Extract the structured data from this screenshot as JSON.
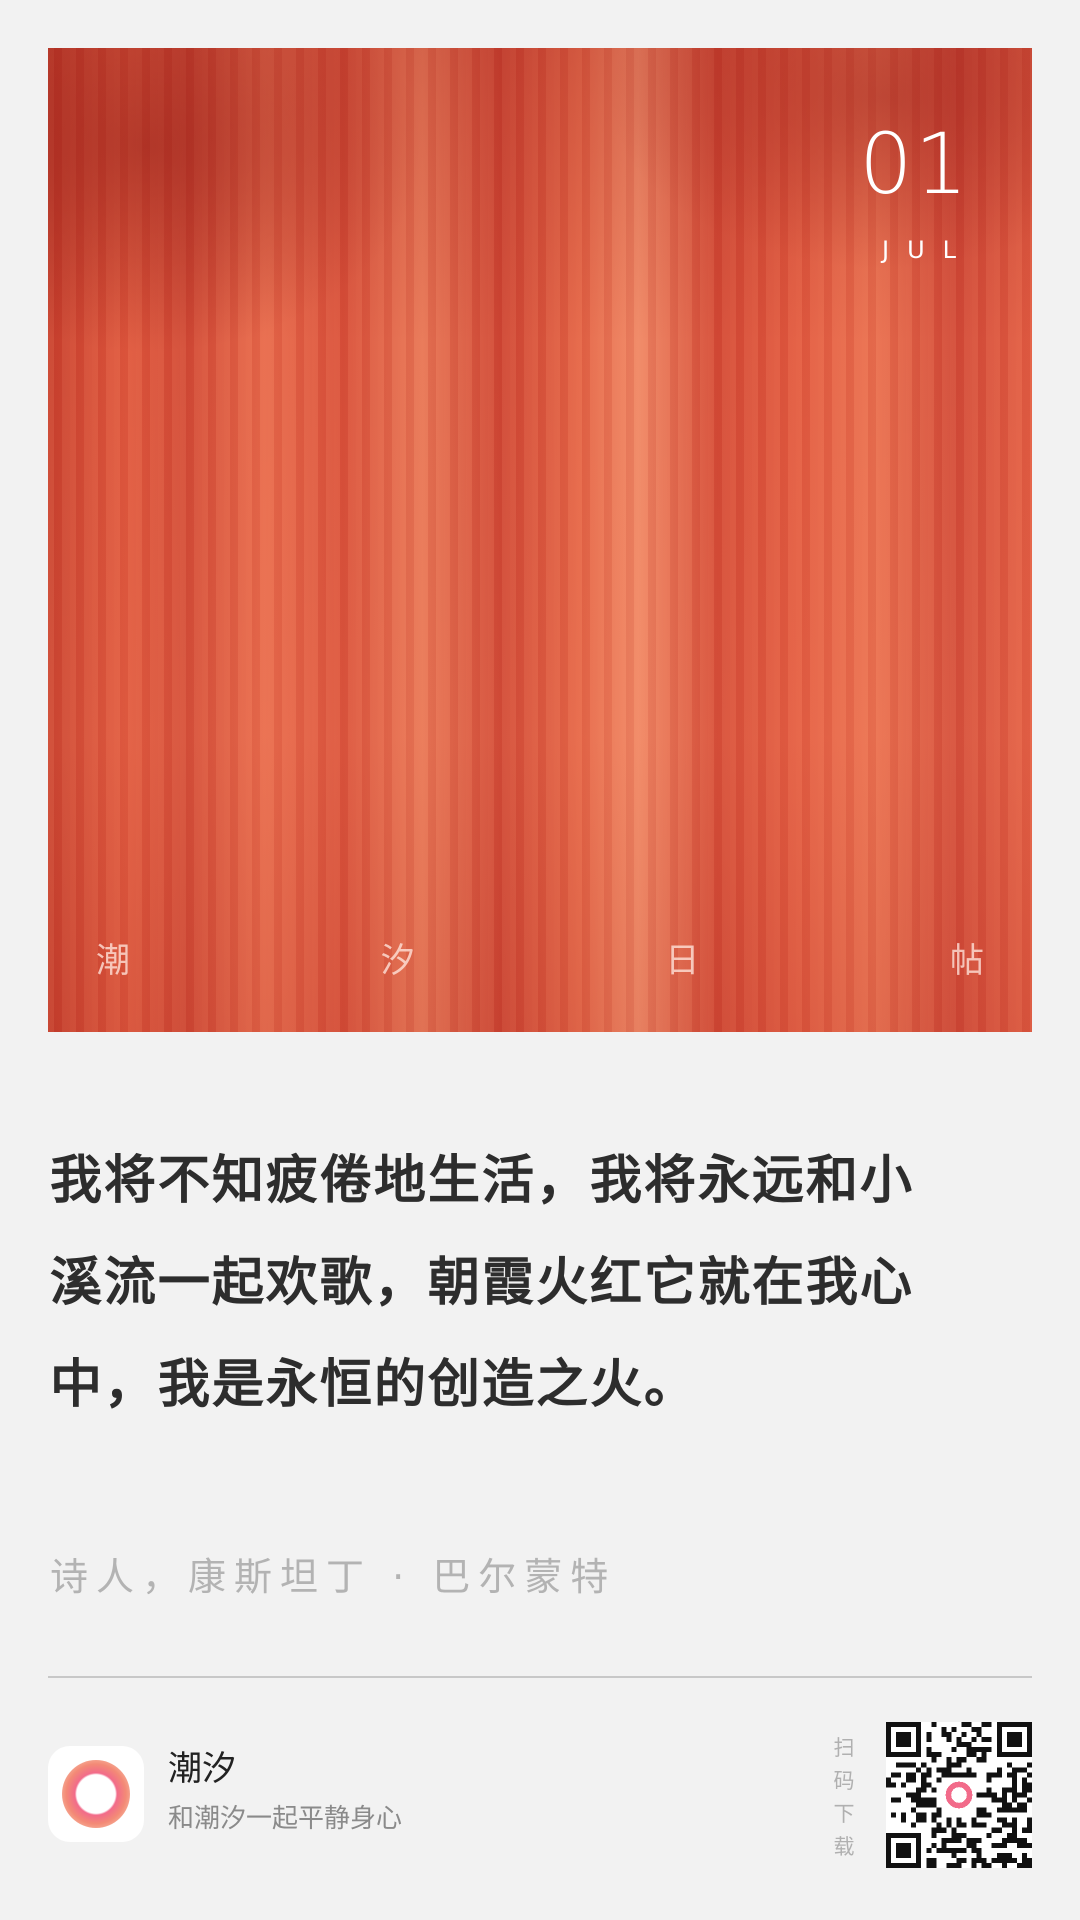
{
  "hero": {
    "date_day": "01",
    "date_month": "JUL",
    "caption": [
      "潮",
      "汐",
      "日",
      "帖"
    ]
  },
  "quote": {
    "lines": [
      "我将不知疲倦地生活，我将永远和小",
      "溪流一起欢歌，朝霞火红它就在我心",
      "中，我是永恒的创造之火。"
    ]
  },
  "author": "诗人，康斯坦丁 · 巴尔蒙特",
  "footer": {
    "app_name": "潮汐",
    "tagline": "和潮汐一起平静身心",
    "scan_hint": [
      "扫",
      "码",
      "下",
      "载"
    ],
    "icon": "tide-app-icon",
    "qr": "download-qr-code"
  },
  "colors": {
    "background": "#f2f2f2",
    "hero": "#e0583e",
    "quote_text": "#2d2d2d",
    "author_text": "#b3b3b3",
    "app_icon_accent": "#f26b8a"
  }
}
